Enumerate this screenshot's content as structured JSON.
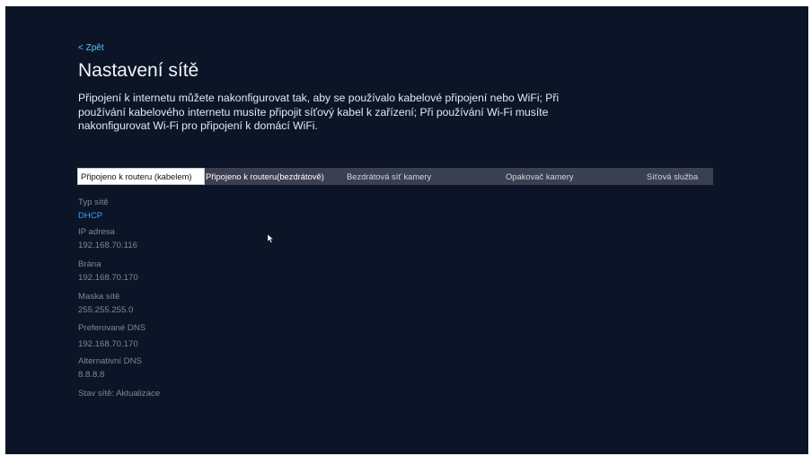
{
  "header": {
    "back_label": "< Zpět",
    "title": "Nastavení sítě",
    "description": "Připojení k internetu můžete nakonfigurovat tak, aby se používalo kabelové připojení nebo WiFi; Při používání kabelového internetu musíte připojit síťový kabel k zařízení; Při používání Wi-Fi musíte nakonfigurovat Wi-Fi pro připojení k domácí WiFi."
  },
  "tabs": [
    {
      "label": "Připojeno k routeru (kabelem)",
      "active": true
    },
    {
      "label": "Připojeno k routeru(bezdrátově)",
      "active": false
    },
    {
      "label": "Bezdrátová síť kamery",
      "active": false
    },
    {
      "label": "Opakovač kamery",
      "active": false
    },
    {
      "label": "Síťová služba",
      "active": false
    }
  ],
  "network_info": [
    {
      "label": "Typ sítě",
      "value": "DHCP"
    },
    {
      "label": "IP adresa",
      "value": "192.168.70.116"
    },
    {
      "label": "Brána",
      "value": "192.168.70.170"
    },
    {
      "label": "Maska sítě",
      "value": "255.255.255.0"
    },
    {
      "label": "Preferované DNS",
      "value": "192.168.70.170"
    },
    {
      "label": "Alternativní DNS",
      "value": "8.8.8.8"
    }
  ],
  "status": {
    "text": "Stav sítě: Aktualizace"
  },
  "colors": {
    "background": "#0b1527",
    "accent": "#3aa0ff",
    "link": "#5fc4ff",
    "tab_bar": "#3a4052",
    "muted_text": "#7f8797"
  },
  "icons": {
    "cursor": "mouse-pointer-icon"
  }
}
